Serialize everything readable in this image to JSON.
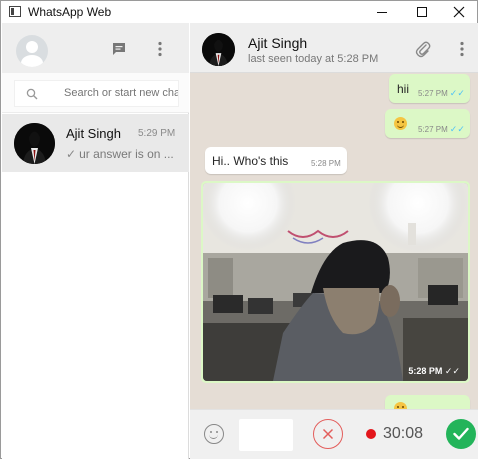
{
  "window": {
    "title": "WhatsApp Web"
  },
  "left_pane": {
    "search": {
      "placeholder": "Search or start new chat"
    },
    "chats": [
      {
        "name": "Ajit Singh",
        "time": "5:29 PM",
        "preview": "ur answer is on ...",
        "preview_tick": "✓"
      }
    ]
  },
  "conversation": {
    "contact_name": "Ajit Singh",
    "status": "last seen today at 5:28 PM",
    "messages": [
      {
        "direction": "out",
        "text": "hii",
        "time": "5:27 PM"
      },
      {
        "direction": "out",
        "text": "",
        "emoji": "smiley",
        "time": "5:27 PM"
      },
      {
        "direction": "in",
        "text": "Hi.. Who's this",
        "time": "5:28 PM"
      },
      {
        "direction": "out",
        "type": "photo",
        "time": "5:28 PM"
      }
    ]
  },
  "recording": {
    "timer": "30:08"
  },
  "icons": {
    "new_chat": "chat-icon",
    "left_menu": "menu-icon",
    "search": "search-icon",
    "attach": "paperclip-icon",
    "right_menu": "menu-icon",
    "emoji": "emoji-icon",
    "cancel": "close-icon",
    "send": "check-icon"
  },
  "colors": {
    "outgoing_bubble": "#dcf8c6",
    "incoming_bubble": "#ffffff",
    "chat_background": "#e5ddd5",
    "read_ticks": "#4fc3f7",
    "record_dot": "#e3161b",
    "send_button": "#23b45a"
  }
}
